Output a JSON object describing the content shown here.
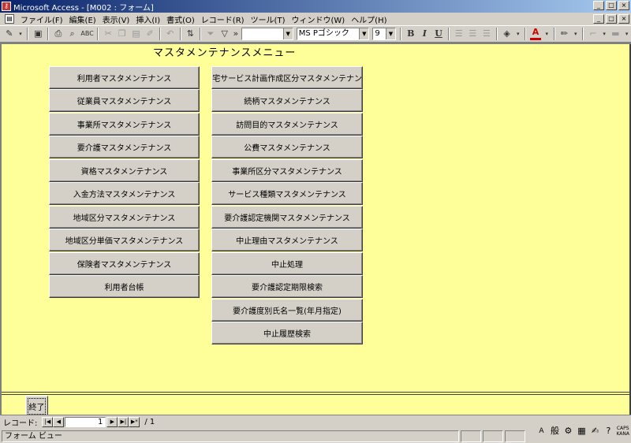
{
  "window": {
    "title": "Microsoft Access - [M002 : フォーム]",
    "controls": [
      "_",
      "□",
      "×"
    ]
  },
  "menubar": {
    "items": [
      "ファイル(F)",
      "編集(E)",
      "表示(V)",
      "挿入(I)",
      "書式(O)",
      "レコード(R)",
      "ツール(T)",
      "ウィンドウ(W)",
      "ヘルプ(H)"
    ]
  },
  "toolbar": {
    "object_combo": "",
    "font_name": "MS Pゴシック",
    "font_size": "9",
    "bold": "B",
    "italic": "I",
    "underline": "U",
    "icons": [
      "design-view-icon",
      "save-icon",
      "print-icon",
      "print-preview-icon",
      "spelling-icon",
      "cut-icon",
      "copy-icon",
      "paste-icon",
      "format-painter-icon",
      "undo-icon",
      "sort-icon",
      "filter-icon",
      "more-icon",
      "align-left-icon",
      "align-center-icon",
      "align-right-icon",
      "fill-color-icon",
      "font-color-icon",
      "line-color-icon",
      "border-icon",
      "line-style-icon"
    ]
  },
  "form": {
    "title": "マスタメンテナンスメニュー",
    "left_buttons": [
      "利用者マスタメンテナンス",
      "従業員マスタメンテナンス",
      "事業所マスタメンテナンス",
      "要介護マスタメンテナンス",
      "資格マスタメンテナンス",
      "入金方法マスタメンテナンス",
      "地域区分マスタメンテナンス",
      "地域区分単価マスタメンテナンス",
      "保険者マスタメンテナンス",
      "利用者台帳"
    ],
    "right_buttons": [
      "居宅サービス計画作成区分マスタメンテナンス",
      "続柄マスタメンテナンス",
      "訪問目的マスタメンテナンス",
      "公費マスタメンテナンス",
      "事業所区分マスタメンテナンス",
      "サービス種類マスタメンテナンス",
      "要介護認定機関マスタメンテナンス",
      "中止理由マスタメンテナンス",
      "中止処理",
      "要介護認定期限検索",
      "要介護度別氏名一覧(年月指定)",
      "中止履歴検索"
    ],
    "exit_label": "終了"
  },
  "navigation": {
    "label": "レコード:",
    "current": "1",
    "total": "/ 1"
  },
  "status": {
    "text": "フォーム ビュー",
    "ime": "般",
    "caps": "CAPS",
    "kana": "KANA"
  }
}
